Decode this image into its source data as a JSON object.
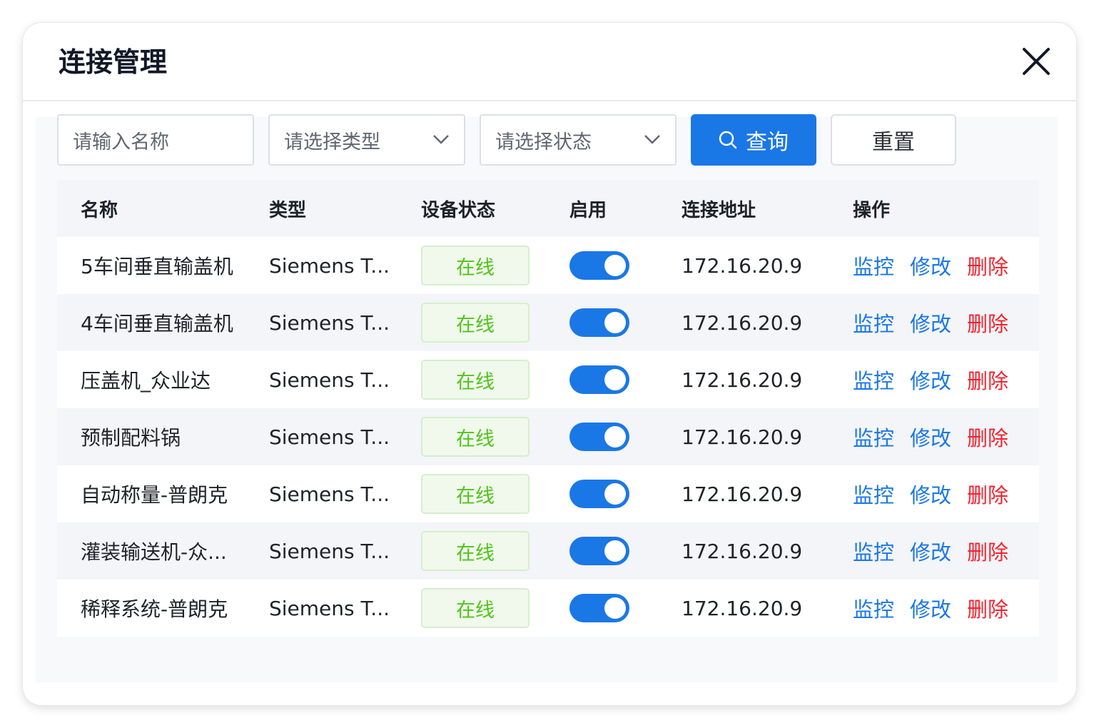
{
  "dialog": {
    "title": "连接管理"
  },
  "filters": {
    "name_placeholder": "请输入名称",
    "type_placeholder": "请选择类型",
    "status_placeholder": "请选择状态",
    "query_label": "查询",
    "reset_label": "重置"
  },
  "table": {
    "headers": [
      "名称",
      "类型",
      "设备状态",
      "启用",
      "连接地址",
      "操作"
    ],
    "rows": [
      {
        "name": "5车间垂直输盖机",
        "type": "Siemens T...",
        "status": "在线",
        "enabled": true,
        "address": "172.16.20.9"
      },
      {
        "name": "4车间垂直输盖机",
        "type": "Siemens T...",
        "status": "在线",
        "enabled": true,
        "address": "172.16.20.9"
      },
      {
        "name": "压盖机_众业达",
        "type": "Siemens T...",
        "status": "在线",
        "enabled": true,
        "address": "172.16.20.9"
      },
      {
        "name": "预制配料锅",
        "type": "Siemens T...",
        "status": "在线",
        "enabled": true,
        "address": "172.16.20.9"
      },
      {
        "name": "自动称量-普朗克",
        "type": "Siemens T...",
        "status": "在线",
        "enabled": true,
        "address": "172.16.20.9"
      },
      {
        "name": "灌装输送机-众...",
        "type": "Siemens T...",
        "status": "在线",
        "enabled": true,
        "address": "172.16.20.9"
      },
      {
        "name": "稀释系统-普朗克",
        "type": "Siemens T...",
        "status": "在线",
        "enabled": true,
        "address": "172.16.20.9"
      }
    ],
    "actions": {
      "monitor": "监控",
      "edit": "修改",
      "delete": "删除"
    }
  },
  "colors": {
    "primary": "#1a77e6",
    "danger": "#f5222d",
    "online": "#52c41a"
  },
  "icons": {
    "close": "close-icon",
    "search": "search-icon",
    "dropdown": "chevron-down-icon"
  }
}
